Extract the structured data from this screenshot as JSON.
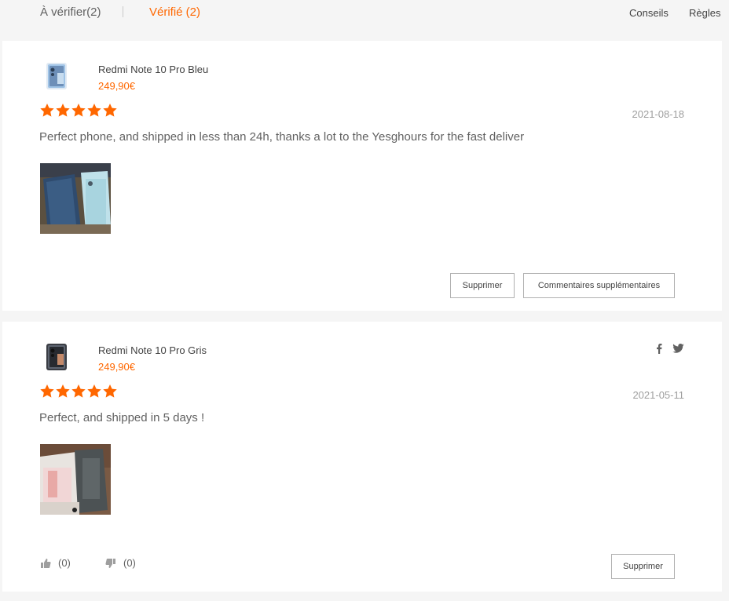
{
  "tabs": {
    "pending": "À vérifier(2)",
    "verified": "Vérifié (2)"
  },
  "links": {
    "tips": "Conseils",
    "rules": "Règles"
  },
  "reviews": [
    {
      "product_name": "Redmi Note 10 Pro Bleu",
      "price": "249,90€",
      "rating": 5,
      "date": "2021-08-18",
      "text": "Perfect phone, and shipped in less than 24h, thanks a lot to the Yesghours for the fast deliver",
      "actions": {
        "delete": "Supprimer",
        "more": "Commentaires supplémentaires"
      }
    },
    {
      "product_name": "Redmi Note 10 Pro Gris",
      "price": "249,90€",
      "rating": 5,
      "date": "2021-05-11",
      "text": "Perfect, and shipped in 5 days !",
      "likes": "(0)",
      "dislikes": "(0)",
      "actions": {
        "delete": "Supprimer"
      }
    }
  ],
  "colors": {
    "accent": "#ff6700",
    "star": "#ff6700",
    "background": "#f5f5f5"
  },
  "icons": {
    "share": [
      "facebook-icon",
      "twitter-icon"
    ],
    "vote": [
      "thumbs-up-icon",
      "thumbs-down-icon"
    ]
  }
}
